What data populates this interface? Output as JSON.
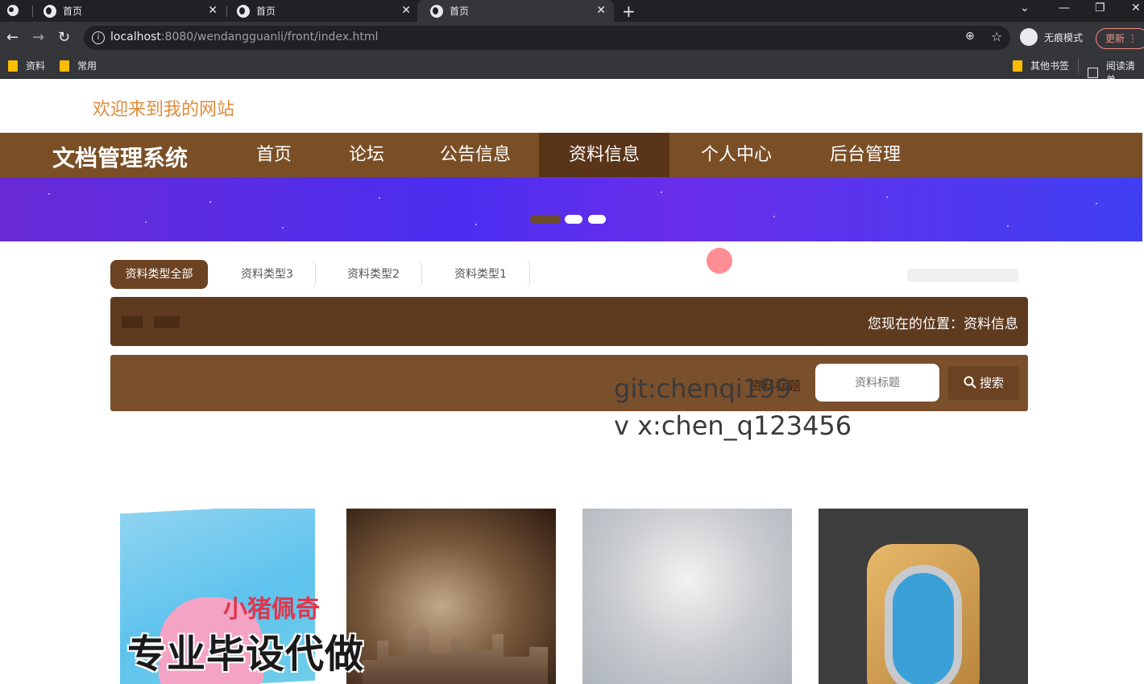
{
  "browser": {
    "tabs": [
      {
        "label": "首页",
        "active": false
      },
      {
        "label": "首页",
        "active": false
      },
      {
        "label": "首页",
        "active": true
      }
    ],
    "url_host": "localhost",
    "url_path": ":8080/wendangguanli/front/index.html",
    "profile_label": "无痕模式",
    "update_label": "更新",
    "bookmarks": [
      "资料",
      "常用"
    ],
    "bookmarks_right": [
      "其他书签",
      "阅读清单"
    ]
  },
  "page": {
    "welcome": "欢迎来到我的网站",
    "brand": "文档管理系统",
    "nav": [
      {
        "label": "首页",
        "active": false
      },
      {
        "label": "论坛",
        "active": false
      },
      {
        "label": "公告信息",
        "active": false
      },
      {
        "label": "资料信息",
        "active": true
      },
      {
        "label": "个人中心",
        "active": false
      },
      {
        "label": "后台管理",
        "active": false
      }
    ],
    "carousel_dots": 3,
    "carousel_active_index": 0,
    "type_tabs": [
      "资料类型全部",
      "资料类型3",
      "资料类型2",
      "资料类型1"
    ],
    "location_text": "您现在的位置：资料信息",
    "search": {
      "label": "资料标题",
      "placeholder": "资料标题",
      "button": "搜索"
    },
    "overlay_line1": "git:chenqi199",
    "overlay_line2": "v x:chen_q123456",
    "card1_title": "小猪佩奇",
    "watermark": "专业毕设代做",
    "colors": {
      "nav_brown": "#7b4f26",
      "nav_active": "#5a3418",
      "welcome_orange": "#e08b3a",
      "location_bar": "#5e3a1f",
      "search_bar": "#7a4f2c"
    }
  }
}
